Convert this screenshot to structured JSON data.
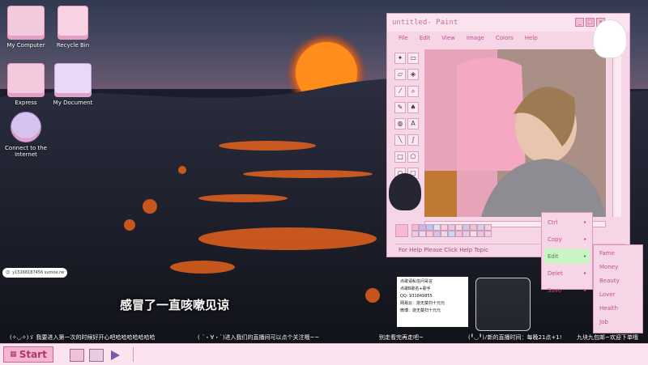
{
  "desktop": {
    "icons": [
      {
        "label": "My Computer",
        "icon": "computer-icon"
      },
      {
        "label": "Recycle Bin",
        "icon": "recycle-bin-icon"
      },
      {
        "label": "Express",
        "icon": "express-folder-icon"
      },
      {
        "label": "My Document",
        "icon": "document-folder-icon"
      },
      {
        "label": "Connect to the Internet",
        "icon": "globe-icon"
      }
    ]
  },
  "paint": {
    "title": "untitled- Paint",
    "menu": [
      "File",
      "Edit",
      "View",
      "Image",
      "Colors",
      "Help"
    ],
    "status": "For Help Please Click Help Topic",
    "palette": [
      "#f7b8d6",
      "#c8b6e8",
      "#b7c9f0",
      "#d7e7f8",
      "#f7cfe1",
      "#e9c4ea",
      "#fbd7e6",
      "#cfc6ee",
      "#f4bfd5",
      "#d9cdef",
      "#f8d0e3",
      "#eec6f0",
      "#e7d8f3",
      "#f9c6dc",
      "#d4c2ec",
      "#f3d6ea",
      "#c9d8f3",
      "#f6c1d8",
      "#e2cdf0",
      "#f9dbe8",
      "#ecc1e3",
      "#f4cce0"
    ]
  },
  "ctx_menu": {
    "items": [
      "Ctrl",
      "Copy",
      "Edit",
      "Delet",
      "Save"
    ],
    "selected": "Edit"
  },
  "sub_menu": {
    "items": [
      "Fame",
      "Money",
      "Beauty",
      "Lover",
      "Health",
      "Job"
    ]
  },
  "subtitle": "感冒了一直咳嗽见谅",
  "badge": {
    "text": "y15268187456 sumoe.rw"
  },
  "notecard": {
    "lines": [
      "点歌请私信问哥言",
      "点歌B歌名+歌手",
      "QQ: 931849855",
      "网易云：烧无葵扫十元元",
      "微博：烧无葵扫十元元"
    ]
  },
  "tickers": [
    "(✧◡✧)ゞ 我要进入第一次的时候好开心吧哈哈哈哈哈哈哈",
    "( ´・∀・`)进入我们的直播间可以点个关注哦~~",
    "别走看完再走吧~",
    "(╹◡╹)ﾉ新的直播时间：每晚21点+1!",
    "九块九包邮~欢迎下单哦"
  ],
  "taskbar": {
    "start_label": "Start"
  },
  "colors": {
    "accent": "#c4508e",
    "window_bg": "#f6d6e6",
    "taskbar_bg": "#fbe3ef",
    "menu_selected": "#caf4c3"
  }
}
